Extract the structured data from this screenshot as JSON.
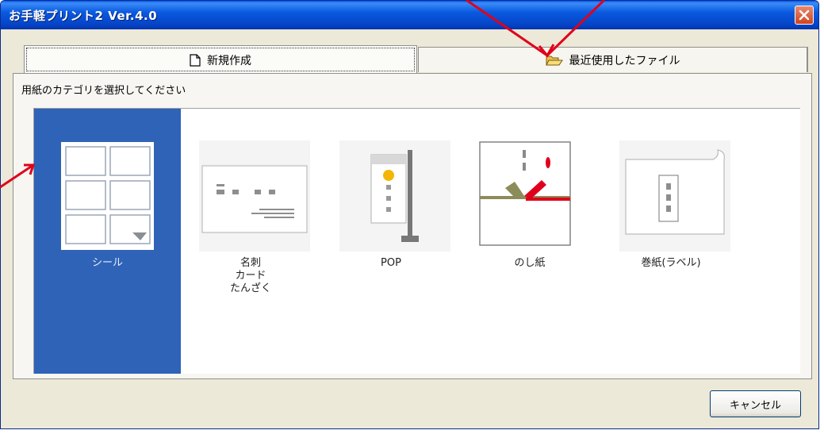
{
  "window": {
    "title": "お手軽プリント2 Ver.4.0",
    "close_icon": "close-icon"
  },
  "tabs": [
    {
      "label": "新規作成",
      "icon": "new-document-icon",
      "active": true
    },
    {
      "label": "最近使用したファイル",
      "icon": "open-folder-icon",
      "active": false
    }
  ],
  "panel": {
    "instruction": "用紙のカテゴリを選択してください",
    "categories": [
      {
        "label": "シール",
        "icon": "sticker-sheet-icon",
        "selected": true
      },
      {
        "label": "名刺\nカード\nたんざく",
        "icon": "business-card-icon",
        "selected": false
      },
      {
        "label": "POP",
        "icon": "pop-banner-icon",
        "selected": false
      },
      {
        "label": "のし紙",
        "icon": "noshi-paper-icon",
        "selected": false
      },
      {
        "label": "巻紙(ラベル)",
        "icon": "roll-paper-icon",
        "selected": false
      }
    ]
  },
  "buttons": {
    "cancel": "キャンセル"
  },
  "colors": {
    "selection": "#2e63b8",
    "annotation_arrow": "#e0001b",
    "titlebar": "#0a5ae0"
  }
}
